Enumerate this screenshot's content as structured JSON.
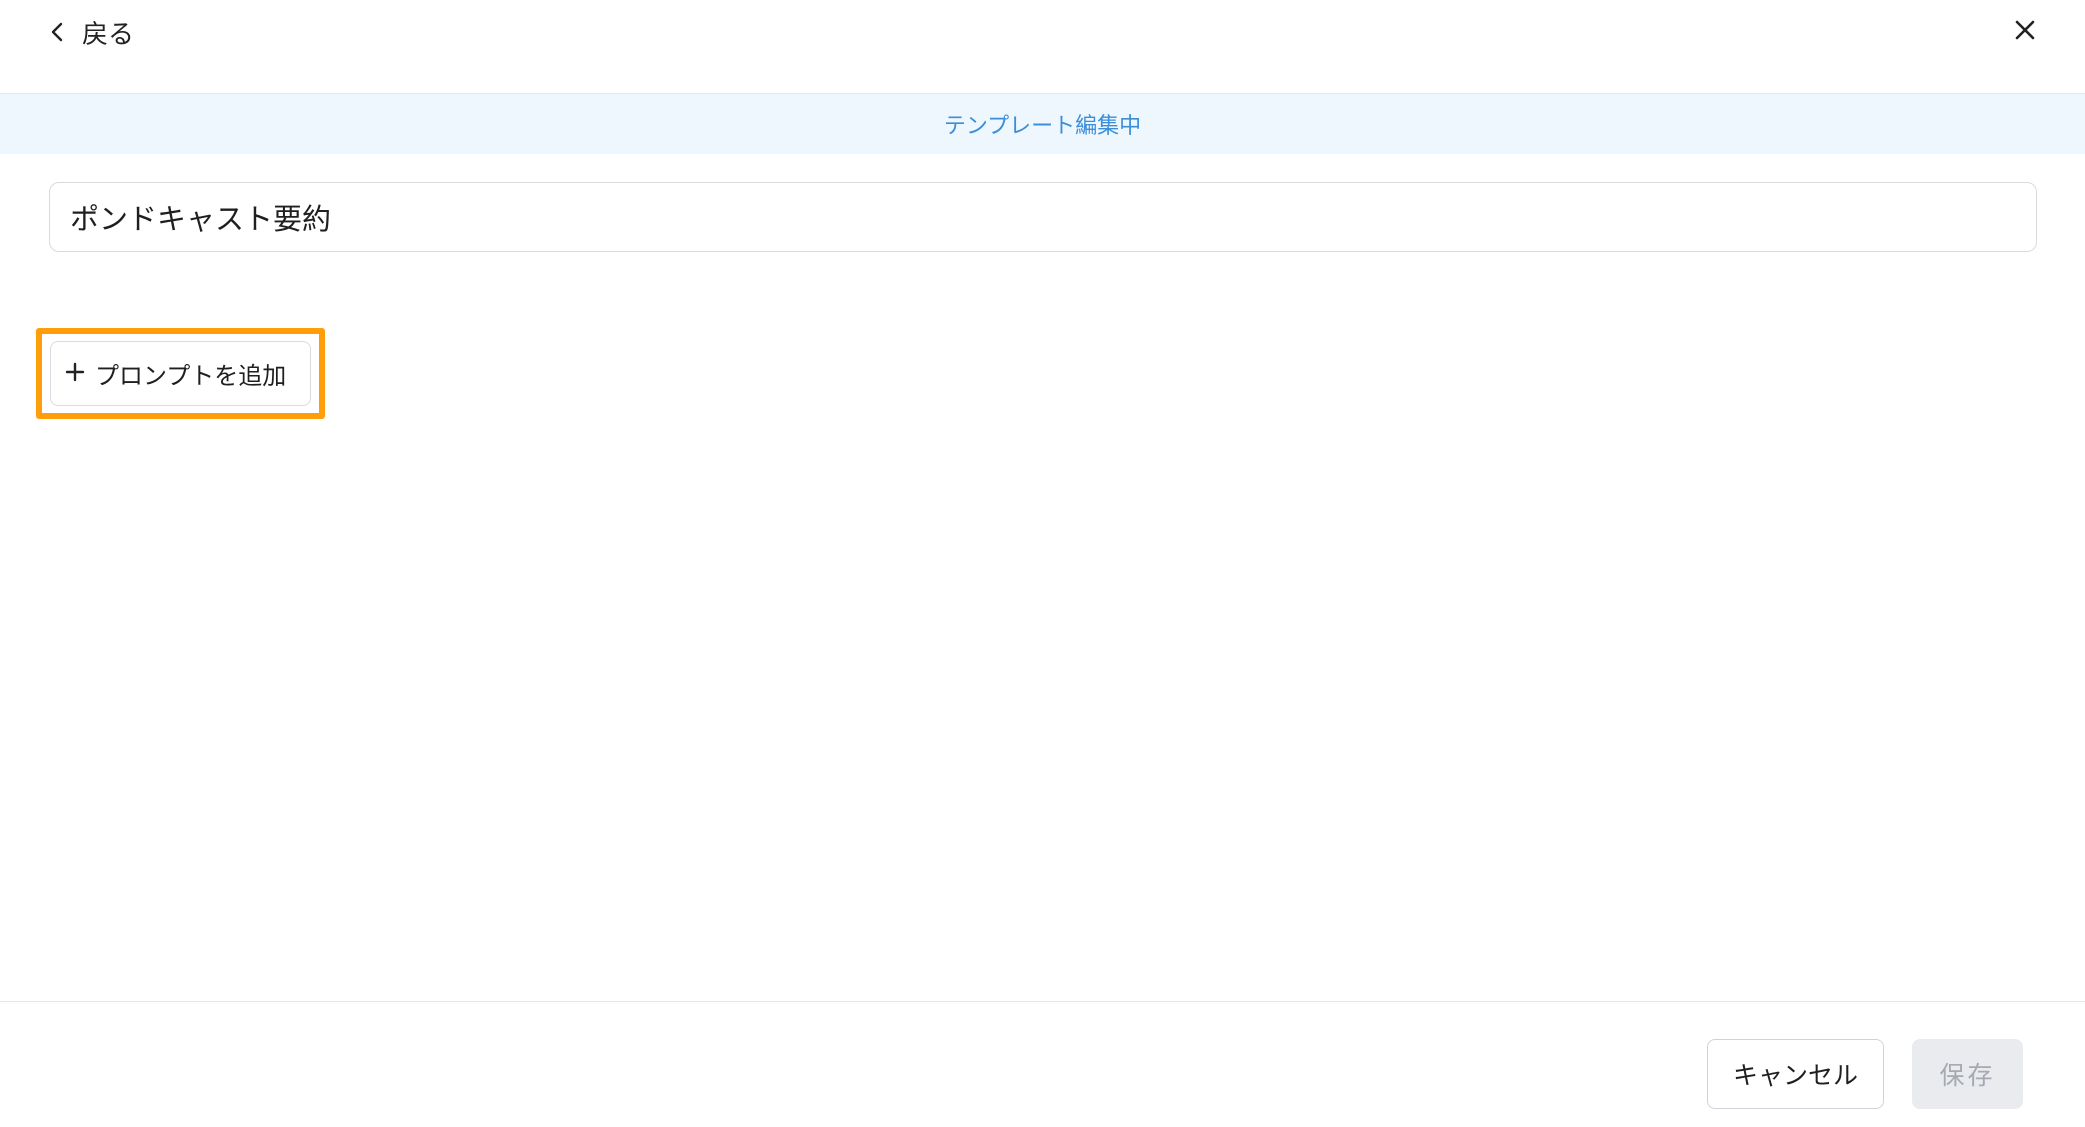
{
  "header": {
    "back_label": "戻る",
    "back_icon": "chevron-left-icon",
    "close_icon": "close-icon"
  },
  "banner": {
    "text": "テンプレート編集中",
    "color": "#3b8ed8",
    "background": "#eef7fd"
  },
  "template": {
    "title_value": "ポンドキャスト要約"
  },
  "add_prompt": {
    "label": "プロンプトを追加",
    "icon": "plus-icon",
    "highlight_color": "#ff9d0a"
  },
  "footer": {
    "cancel_label": "キャンセル",
    "save_label": "保存",
    "save_enabled": false
  }
}
